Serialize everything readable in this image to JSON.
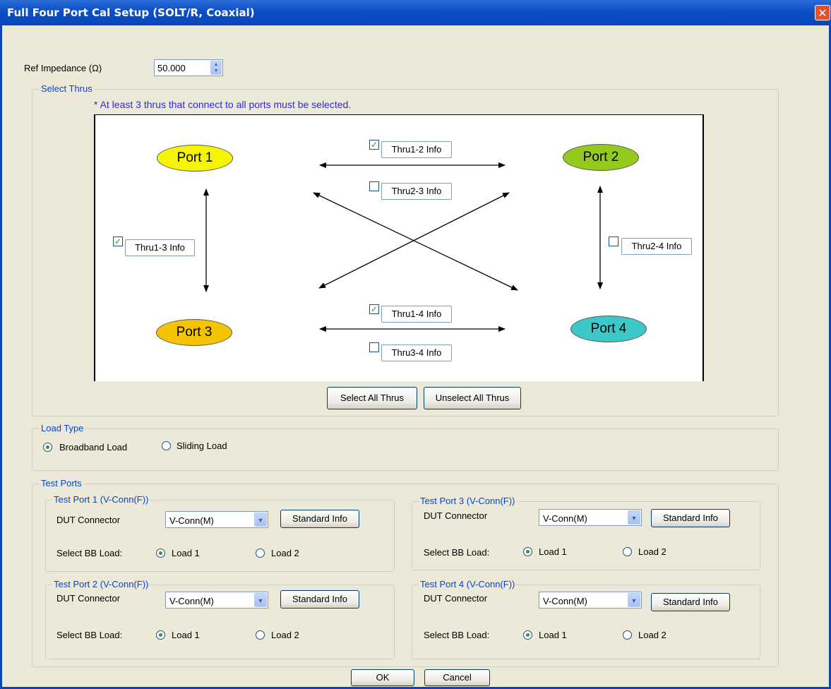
{
  "window": {
    "title": "Full Four Port Cal Setup (SOLT/R, Coaxial)",
    "close_glyph": "✕"
  },
  "ref_impedance": {
    "label": "Ref Impedance (Ω)",
    "value": "50.000"
  },
  "select_thrus": {
    "label": "Select Thrus",
    "note": "* At least 3 thrus that connect to all ports must be selected.",
    "ports": [
      "Port 1",
      "Port 2",
      "Port 3",
      "Port 4"
    ],
    "port_colors": [
      "#f5f500",
      "#94c91e",
      "#f5c400",
      "#3dc8c8"
    ],
    "thrus": [
      {
        "label": "Thru1-2 Info",
        "checked": true
      },
      {
        "label": "Thru2-3 Info",
        "checked": false
      },
      {
        "label": "Thru1-3 Info",
        "checked": true
      },
      {
        "label": "Thru2-4 Info",
        "checked": false
      },
      {
        "label": "Thru1-4 Info",
        "checked": true
      },
      {
        "label": "Thru3-4 Info",
        "checked": false
      }
    ],
    "select_all": "Select All Thrus",
    "unselect_all": "Unselect All Thrus"
  },
  "load_type": {
    "label": "Load Type",
    "options": [
      {
        "label": "Broadband Load",
        "selected": true
      },
      {
        "label": "Sliding Load",
        "selected": false
      }
    ]
  },
  "test_ports": {
    "label": "Test Ports",
    "ports": [
      {
        "title": "Test Port 1 (V-Conn(F))",
        "dut_label": "DUT Connector",
        "dut_value": "V-Conn(M)",
        "std_button": "Standard Info",
        "bb_label": "Select BB Load:",
        "load1": "Load 1",
        "load2": "Load 2",
        "selected_load": 1
      },
      {
        "title": "Test Port 3 (V-Conn(F))",
        "dut_label": "DUT Connector",
        "dut_value": "V-Conn(M)",
        "std_button": "Standard Info",
        "bb_label": "Select BB Load:",
        "load1": "Load 1",
        "load2": "Load 2",
        "selected_load": 1
      },
      {
        "title": "Test Port 2 (V-Conn(F))",
        "dut_label": "DUT Connector",
        "dut_value": "V-Conn(M)",
        "std_button": "Standard Info",
        "bb_label": "Select BB Load:",
        "load1": "Load 1",
        "load2": "Load 2",
        "selected_load": 1
      },
      {
        "title": "Test Port 4 (V-Conn(F))",
        "dut_label": "DUT Connector",
        "dut_value": "V-Conn(M)",
        "std_button": "Standard Info",
        "bb_label": "Select BB Load:",
        "load1": "Load 1",
        "load2": "Load 2",
        "selected_load": 1
      }
    ]
  },
  "buttons": {
    "ok": "OK",
    "cancel": "Cancel"
  }
}
